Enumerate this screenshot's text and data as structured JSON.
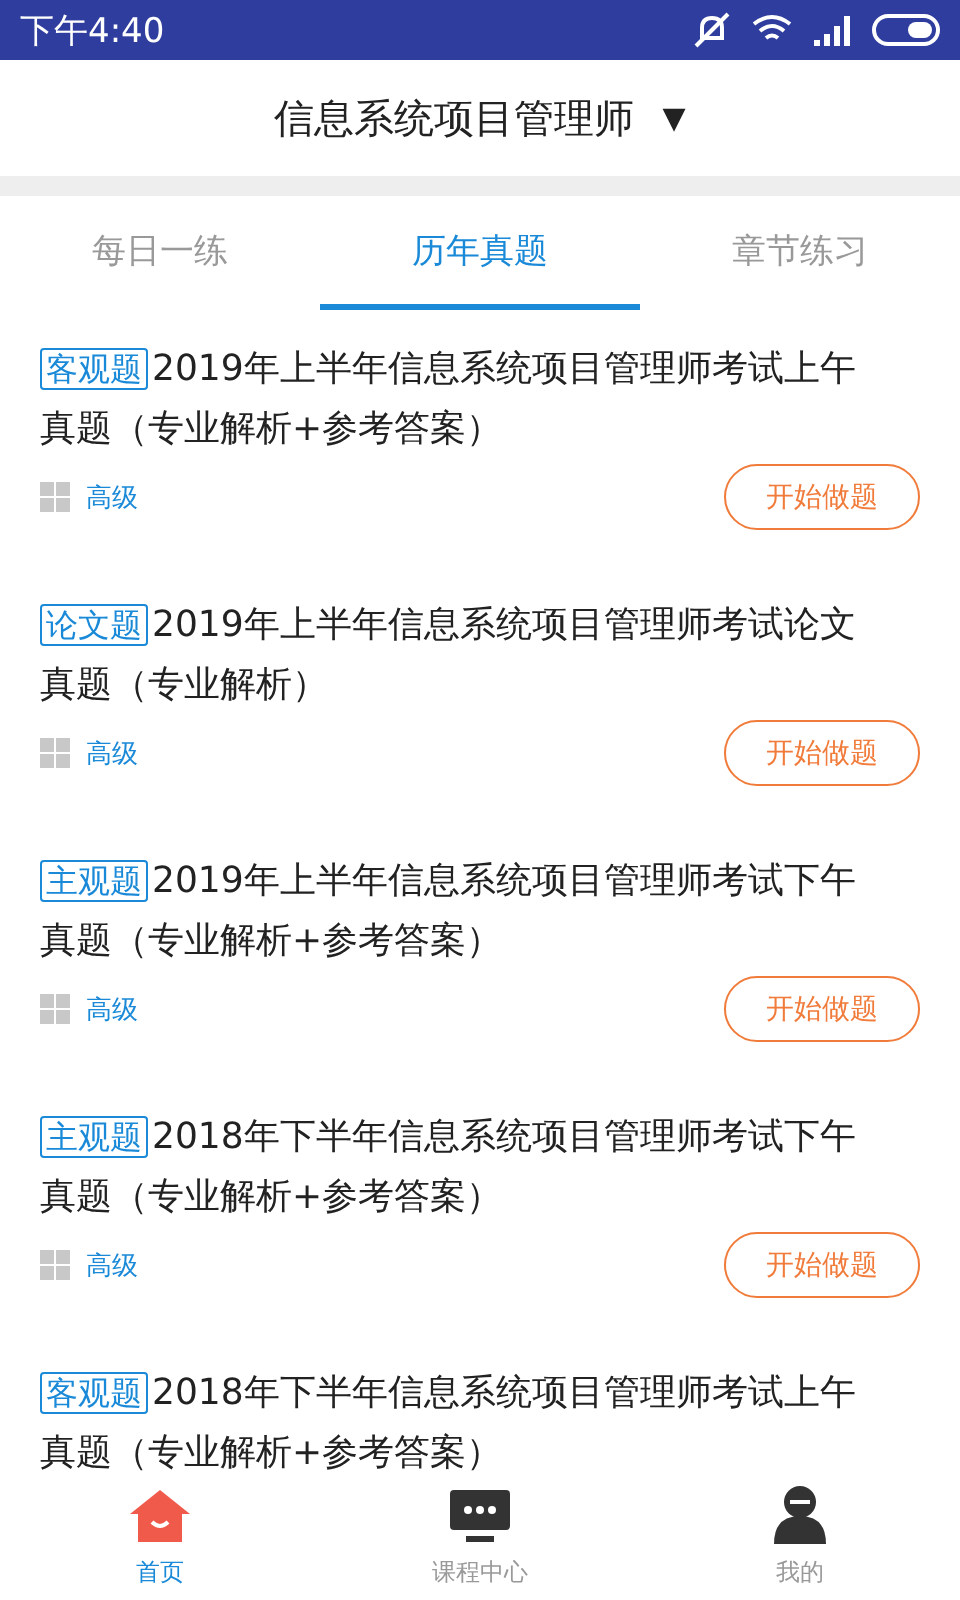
{
  "status_bar": {
    "time": "下午4:40"
  },
  "header": {
    "title": "信息系统项目管理师",
    "dropdown": "▼"
  },
  "tabs": [
    {
      "label": "每日一练",
      "selected": false
    },
    {
      "label": "历年真题",
      "selected": true
    },
    {
      "label": "章节练习",
      "selected": false
    }
  ],
  "exams": [
    {
      "tag": "客观题",
      "title": "2019年上半年信息系统项目管理师考试上午真题（专业解析+参考答案）",
      "difficulty": "高级",
      "button": "开始做题"
    },
    {
      "tag": "论文题",
      "title": "2019年上半年信息系统项目管理师考试论文真题（专业解析）",
      "difficulty": "高级",
      "button": "开始做题"
    },
    {
      "tag": "主观题",
      "title": "2019年上半年信息系统项目管理师考试下午真题（专业解析+参考答案）",
      "difficulty": "高级",
      "button": "开始做题"
    },
    {
      "tag": "主观题",
      "title": "2018年下半年信息系统项目管理师考试下午真题（专业解析+参考答案）",
      "difficulty": "高级",
      "button": "开始做题"
    },
    {
      "tag": "客观题",
      "title": "2018年下半年信息系统项目管理师考试上午真题（专业解析+参考答案）"
    }
  ],
  "bottom_nav": [
    {
      "label": "首页",
      "kind": "home",
      "selected": true
    },
    {
      "label": "课程中心",
      "kind": "course",
      "selected": false
    },
    {
      "label": "我的",
      "kind": "profile",
      "selected": false
    }
  ]
}
